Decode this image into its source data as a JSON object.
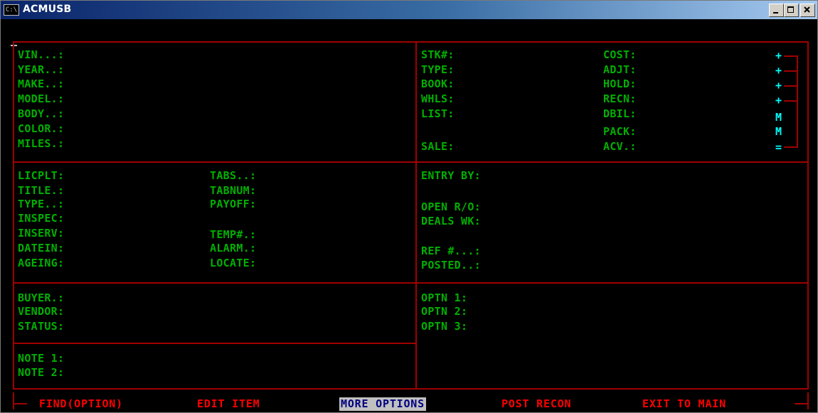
{
  "window": {
    "title": "ACMUSB",
    "icon_text": "C:\\"
  },
  "vehicle": {
    "vin": "VIN...:",
    "year": "YEAR..:",
    "make": "MAKE..:",
    "model": "MODEL.:",
    "body": "BODY..:",
    "color": "COLOR.:",
    "miles": "MILES.:"
  },
  "pricing": {
    "left": {
      "stk": "STK#:",
      "type": "TYPE:",
      "book": "BOOK:",
      "whls": "WHLS:",
      "list": "LIST:",
      "sale": "SALE:"
    },
    "right": {
      "cost": "COST:",
      "adjt": "ADJT:",
      "hold": "HOLD:",
      "recn": "RECN:",
      "dbil": "DBIL:",
      "pack": "PACK:",
      "acv": "ACV.:"
    },
    "markers": [
      "+",
      "+",
      "+",
      "+",
      "M",
      "M",
      "="
    ]
  },
  "registration": {
    "left": {
      "licplt": "LICPLT:",
      "title": "TITLE.:",
      "type": "TYPE..:",
      "inspec": "INSPEC:",
      "inserv": "INSERV:",
      "datein": "DATEIN:",
      "ageing": "AGEING:"
    },
    "right": {
      "tabs": "TABS..:",
      "tabnum": "TABNUM:",
      "payoff": "PAYOFF:",
      "temp": "TEMP#.:",
      "alarm": "ALARM.:",
      "locate": "LOCATE:"
    }
  },
  "entry": {
    "entry_by": "ENTRY BY:",
    "open_ro": "OPEN R/O:",
    "deals_wk": "DEALS WK:",
    "ref": "REF #...:",
    "posted": "POSTED..:"
  },
  "purchase": {
    "buyer": "BUYER.:",
    "vendor": "VENDOR:",
    "status": "STATUS:"
  },
  "options": {
    "optn1": "OPTN 1:",
    "optn2": "OPTN 2:",
    "optn3": "OPTN 3:"
  },
  "notes": {
    "note1": "NOTE 1:",
    "note2": "NOTE 2:"
  },
  "menu": {
    "find": "FIND(OPTION)",
    "edit": "EDIT ITEM",
    "more": "MORE OPTIONS",
    "post": "POST RECON",
    "exit": "EXIT TO MAIN",
    "selected": "MORE OPTIONS"
  },
  "colors": {
    "background": "#000000",
    "label_green": "#00b000",
    "border_red": "#a00000",
    "menu_red": "#ff0000",
    "marker_cyan": "#00ffff",
    "highlight_bg": "#c0c0c0",
    "highlight_fg": "#000080"
  }
}
